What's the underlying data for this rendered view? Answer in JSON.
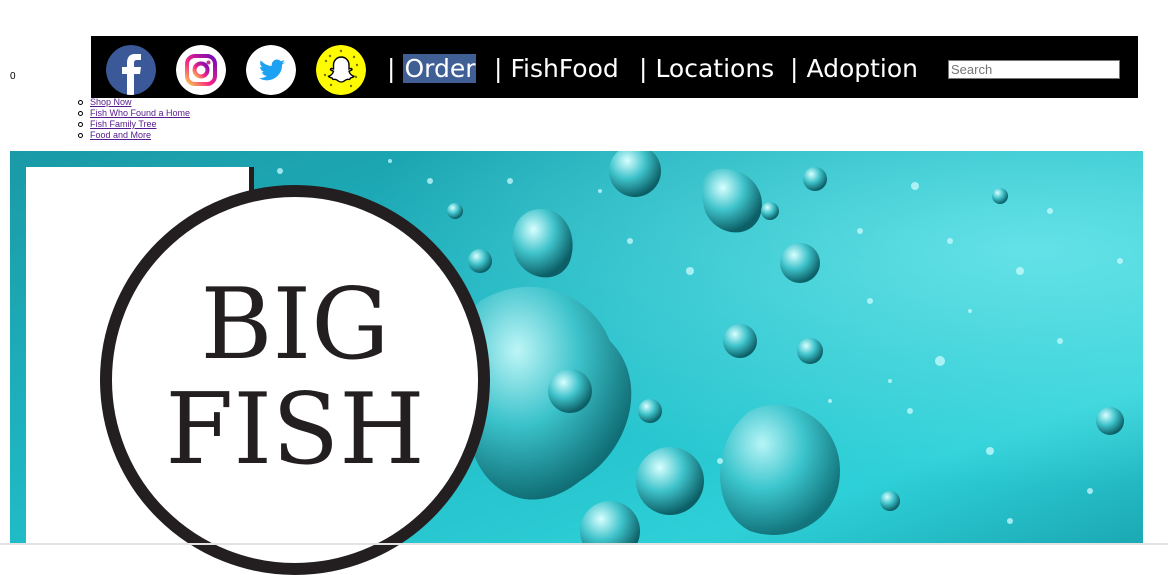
{
  "counter": "0",
  "social": [
    {
      "name": "facebook",
      "icon": "facebook-icon"
    },
    {
      "name": "instagram",
      "icon": "instagram-icon"
    },
    {
      "name": "twitter",
      "icon": "twitter-icon"
    },
    {
      "name": "snapchat",
      "icon": "snapchat-icon"
    }
  ],
  "nav": {
    "separator": "|",
    "items": [
      {
        "label": "Order",
        "active": true
      },
      {
        "label": "FishFood"
      },
      {
        "label": "Locations"
      },
      {
        "label": "Adoption"
      }
    ]
  },
  "search": {
    "placeholder": "Search",
    "value": ""
  },
  "submenu": [
    "Shop Now",
    "Fish Who Found a Home",
    "Fish Family Tree",
    "Food and More"
  ],
  "logo": {
    "line1": "BIG",
    "line2": "FISH"
  },
  "colors": {
    "navbar": "#000000",
    "active_highlight": "#3f5f95",
    "link": "#551a8b",
    "water": "#1eb7c3"
  }
}
